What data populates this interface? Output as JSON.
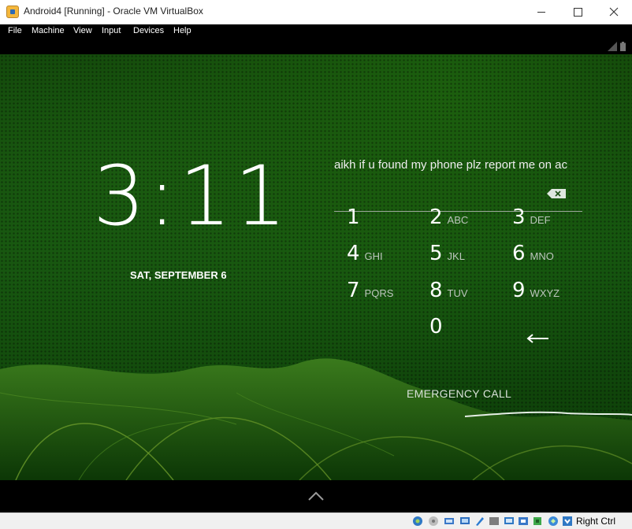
{
  "window": {
    "title": "Android4 [Running] - Oracle VM VirtualBox"
  },
  "menu": {
    "items": [
      "File",
      "Machine",
      "View",
      "Input",
      "Devices",
      "Help"
    ]
  },
  "lockscreen": {
    "time": "3:11",
    "date": "SAT, SEPTEMBER 6",
    "owner_info": "aikh  if u found my phone plz report me on  ac",
    "keypad": [
      {
        "digit": "1",
        "letters": ""
      },
      {
        "digit": "2",
        "letters": "ABC"
      },
      {
        "digit": "3",
        "letters": "DEF"
      },
      {
        "digit": "4",
        "letters": "GHI"
      },
      {
        "digit": "5",
        "letters": "JKL"
      },
      {
        "digit": "6",
        "letters": "MNO"
      },
      {
        "digit": "7",
        "letters": "PQRS"
      },
      {
        "digit": "8",
        "letters": "TUV"
      },
      {
        "digit": "9",
        "letters": "WXYZ"
      },
      {
        "digit": "0",
        "letters": ""
      }
    ],
    "emergency_label": "EMERGENCY CALL"
  },
  "statusbar": {
    "host_key": "Right Ctrl"
  },
  "icons": {
    "app": "virtualbox-icon",
    "backspace": "backspace-icon",
    "enter": "enter-icon",
    "unlock": "chevron-up-icon"
  }
}
